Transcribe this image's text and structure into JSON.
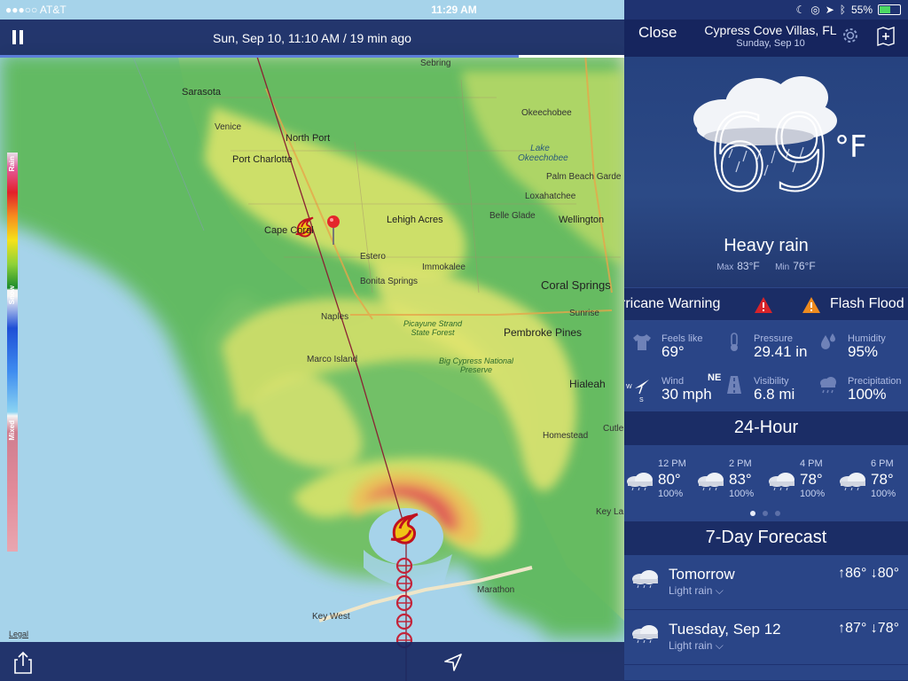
{
  "status_bar": {
    "carrier": "●●●○○ AT&T",
    "time": "11:29 AM",
    "battery": "55%",
    "battery_level": 0.55
  },
  "map": {
    "timestamp": "Sun, Sep 10, 11:10 AM / 19 min ago",
    "legend": {
      "rain": "Rain",
      "snow": "Snow",
      "mixed": "Mixed"
    },
    "legal": "Legal",
    "places": {
      "sarasota": "Sarasota",
      "sebring": "Sebring",
      "venice": "Venice",
      "north_port": "North Port",
      "port_charlotte": "Port Charlotte",
      "okeechobee": "Okeechobee",
      "lake_okeechobee": "Lake Okeechobee",
      "palm_beach_gardens": "Palm Beach Garde",
      "loxahatchee": "Loxahatchee",
      "belle_glade": "Belle Glade",
      "wellington": "Wellington",
      "cape_coral": "Cape Coral",
      "lehigh_acres": "Lehigh Acres",
      "estero": "Estero",
      "immokalee": "Immokalee",
      "bonita_springs": "Bonita Springs",
      "coral_springs": "Coral Springs",
      "naples": "Naples",
      "sunrise": "Sunrise",
      "picayune": "Picayune Strand State Forest",
      "pembroke_pines": "Pembroke Pines",
      "marco_island": "Marco Island",
      "big_cypress": "Big Cypress National Preserve",
      "hialeah": "Hialeah",
      "homestead": "Homestead",
      "cutler": "Cutle",
      "key_largo": "Key La",
      "marathon": "Marathon",
      "key_west": "Key West"
    }
  },
  "panel": {
    "close_label": "Close",
    "location": "Cypress Cove Villas, FL",
    "date": "Sunday, Sep 10",
    "temperature": "69",
    "unit": "°F",
    "condition": "Heavy rain",
    "max_label": "Max",
    "max_value": "83°F",
    "min_label": "Min",
    "min_value": "76°F",
    "alerts": [
      "rricane Warning",
      "Flash Flood"
    ],
    "details": [
      {
        "label": "Feels like",
        "value": "69°"
      },
      {
        "label": "Pressure",
        "value": "29.41 in"
      },
      {
        "label": "Humidity",
        "value": "95%"
      },
      {
        "label": "Wind",
        "value": "30 mph",
        "direction": "NE"
      },
      {
        "label": "Visibility",
        "value": "6.8 mi"
      },
      {
        "label": "Precipitation",
        "value": "100%"
      }
    ],
    "compass": {
      "w": "W",
      "s": "S"
    },
    "hourly_title": "24-Hour",
    "hourly": [
      {
        "time": "12 PM",
        "temp": "80°",
        "precip": "100%"
      },
      {
        "time": "2 PM",
        "temp": "83°",
        "precip": "100%"
      },
      {
        "time": "4 PM",
        "temp": "78°",
        "precip": "100%"
      },
      {
        "time": "6 PM",
        "temp": "78°",
        "precip": "100%"
      }
    ],
    "forecast_title": "7-Day Forecast",
    "days": [
      {
        "name": "Tomorrow",
        "summary": "Light rain ⌵",
        "hilo": "↑86° ↓80°"
      },
      {
        "name": "Tuesday, Sep 12",
        "summary": "Light rain ⌵",
        "hilo": "↑87° ↓78°"
      }
    ]
  }
}
